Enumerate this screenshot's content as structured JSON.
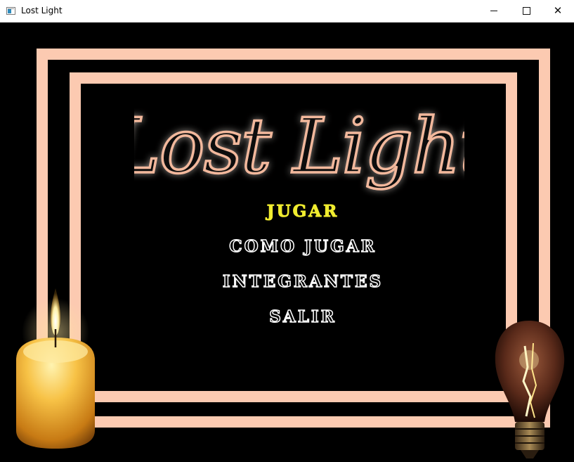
{
  "window": {
    "title": "Lost Light"
  },
  "game": {
    "logo_text": "Lost Light",
    "menu": {
      "items": [
        {
          "label": "JUGAR",
          "selected": true
        },
        {
          "label": "COMO JUGAR",
          "selected": false
        },
        {
          "label": "INTEGRANTES",
          "selected": false
        },
        {
          "label": "SALIR",
          "selected": false
        }
      ]
    },
    "colors": {
      "frame": "#fccab1",
      "selected_item": "#f0ec2f",
      "menu_item": "#ffffff",
      "background": "#000000"
    }
  }
}
